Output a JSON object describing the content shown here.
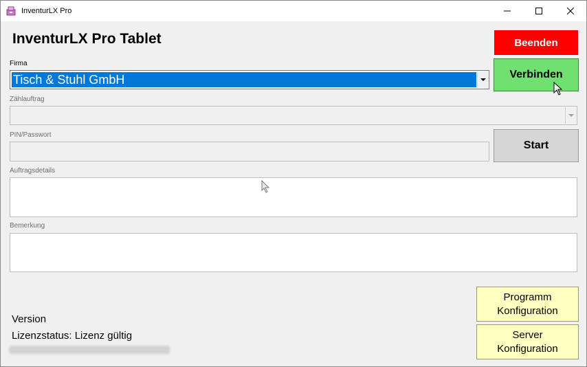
{
  "window": {
    "title": "InventurLX Pro",
    "icon": "inventory-app-icon"
  },
  "header": {
    "app_title": "InventurLX Pro Tablet"
  },
  "form": {
    "firma_label": "Firma",
    "firma_value": "Tisch & Stuhl GmbH",
    "zaehlauftrag_label": "Zählauftrag",
    "zaehlauftrag_value": "",
    "pin_label": "PIN/Passwort",
    "pin_value": "",
    "auftragsdetails_label": "Auftragsdetails",
    "auftragsdetails_value": "",
    "bemerkung_label": "Bemerkung",
    "bemerkung_value": ""
  },
  "buttons": {
    "beenden": "Beenden",
    "verbinden": "Verbinden",
    "start": "Start",
    "programm_konfig_line1": "Programm",
    "programm_konfig_line2": "Konfiguration",
    "server_konfig_line1": "Server",
    "server_konfig_line2": "Konfiguration"
  },
  "footer": {
    "version": "Version",
    "lizenzstatus": "Lizenzstatus: Lizenz gültig"
  },
  "colors": {
    "beenden_bg": "#ff0000",
    "verbinden_bg": "#70e070",
    "start_bg": "#d6d6d6",
    "config_bg": "#ffffc0",
    "selection_bg": "#0078d7"
  }
}
